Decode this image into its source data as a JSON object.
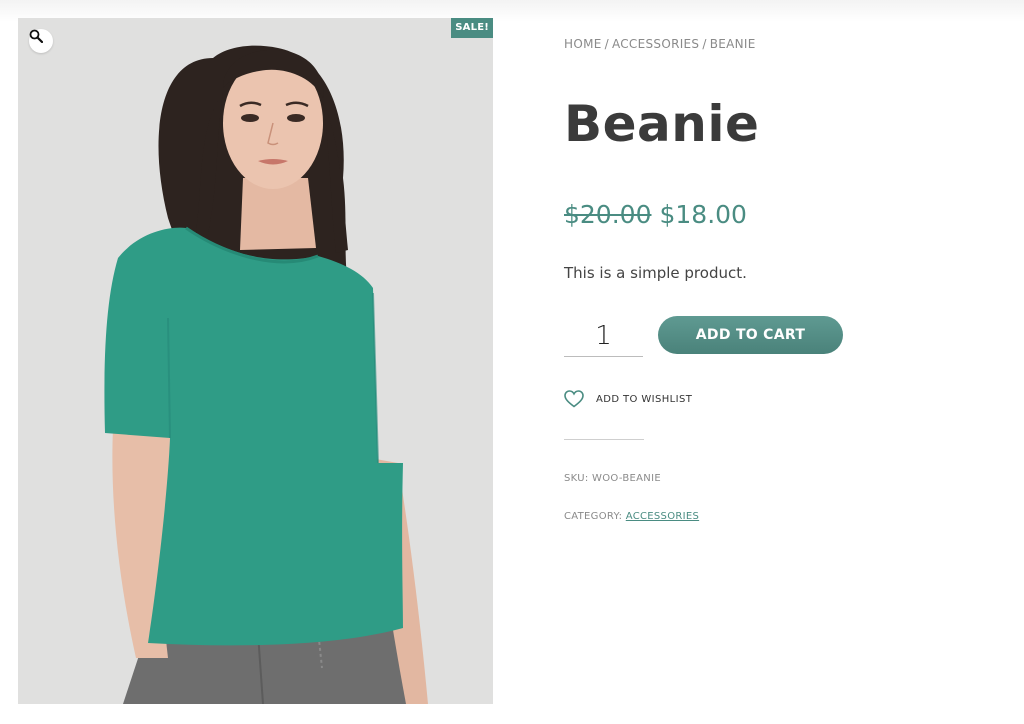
{
  "product": {
    "badge": "SALE!",
    "breadcrumb": {
      "home": "HOME",
      "separator": "/",
      "category": "ACCESSORIES",
      "current": "BEANIE"
    },
    "title": "Beanie",
    "price": {
      "regular": "$20.00",
      "sale": "$18.00"
    },
    "description": "This is a simple product.",
    "quantity": "1",
    "add_to_cart_label": "ADD TO CART",
    "wishlist_label": "ADD TO WISHLIST",
    "sku_label": "SKU:",
    "sku": "WOO-BEANIE",
    "category_label": "CATEGORY:",
    "category": "ACCESSORIES"
  },
  "icons": {
    "zoom": "magnifier-icon",
    "wishlist": "heart-icon"
  },
  "colors": {
    "accent": "#4a8c82",
    "title": "#3b3b3b",
    "shirt": "#2f9c86",
    "pants": "#6d6d6d",
    "hair": "#2b211d",
    "skin": "#e9c2ad"
  }
}
